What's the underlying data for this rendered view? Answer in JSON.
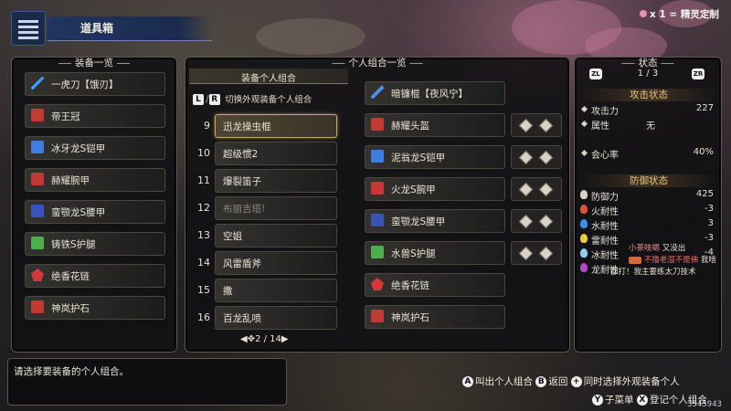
{
  "header": {
    "title": "道具箱"
  },
  "top_right": {
    "text": "x 1 = 精灵定制"
  },
  "equip_panel": {
    "title": "装备一览",
    "items": [
      {
        "label": "一虎刀【饿刃】",
        "icon": "long-sword-icon"
      },
      {
        "label": "帝王冠",
        "icon": "helm-icon"
      },
      {
        "label": "冰牙龙S铠甲",
        "icon": "chest-armor-icon"
      },
      {
        "label": "赫耀腕甲",
        "icon": "arm-armor-icon"
      },
      {
        "label": "蛮颚龙S腰甲",
        "icon": "waist-armor-icon"
      },
      {
        "label": "铸铁S护腿",
        "icon": "leg-armor-icon"
      },
      {
        "label": "绝香花链",
        "icon": "charm-icon"
      },
      {
        "label": "神岚护石",
        "icon": "talisman-icon"
      }
    ]
  },
  "loadout_panel": {
    "title": "个人组合一览",
    "subtitle": "装备个人组合",
    "switch_text": "切换外观装备个人组合",
    "switch_keys": [
      "L",
      "R"
    ],
    "slots": [
      {
        "num": "9",
        "label": "迅龙操虫棍",
        "selected": true
      },
      {
        "num": "10",
        "label": "超级惯2"
      },
      {
        "num": "11",
        "label": "爆裂笛子"
      },
      {
        "num": "12",
        "label": "布丽吉塔!",
        "dim": true
      },
      {
        "num": "13",
        "label": "空姐"
      },
      {
        "num": "14",
        "label": "风雷盾斧"
      },
      {
        "num": "15",
        "label": "撒"
      },
      {
        "num": "16",
        "label": "百龙乱喷"
      }
    ],
    "page": "2 / 14",
    "preview": [
      {
        "label": "暗镰棍【夜风宁】",
        "icon": "insect-glaive-icon"
      },
      {
        "label": "赫耀头盔",
        "icon": "helm-icon"
      },
      {
        "label": "泥翁龙S铠甲",
        "icon": "chest-armor-icon"
      },
      {
        "label": "火龙S腕甲",
        "icon": "arm-armor-icon"
      },
      {
        "label": "蛮颚龙S腰甲",
        "icon": "waist-armor-icon"
      },
      {
        "label": "水兽S护腿",
        "icon": "leg-armor-icon"
      },
      {
        "label": "绝香花链",
        "icon": "charm-icon"
      },
      {
        "label": "神岚护石",
        "icon": "talisman-icon"
      }
    ]
  },
  "status_panel": {
    "title": "状态",
    "page": "1 / 3",
    "attack_header": "攻击状态",
    "attack": [
      {
        "k": "攻击力",
        "v": "227"
      },
      {
        "k": "属性",
        "v": "无"
      },
      {
        "k": "会心率",
        "v": "40%"
      }
    ],
    "defense_header": "防御状态",
    "defense": [
      {
        "k": "防御力",
        "v": "425",
        "color": "#d8d3c4"
      },
      {
        "k": "火耐性",
        "v": "-3",
        "color": "#e0503a"
      },
      {
        "k": "水耐性",
        "v": "3",
        "color": "#3b8fe8"
      },
      {
        "k": "雷耐性",
        "v": "-3",
        "color": "#e8cf3a"
      },
      {
        "k": "冰耐性",
        "v": "-4",
        "color": "#8fd0f0"
      },
      {
        "k": "龙耐性",
        "v": "",
        "color": "#b04ac8"
      }
    ]
  },
  "chat": {
    "line1_name": "小茶吱嗯",
    "line1_text": "又没出",
    "line2_text": "不撸老湿不是佛",
    "line2_tail": "我啥",
    "line3_text": "都打！我主要练太刀技术"
  },
  "message": "请选择要装备的个人组合。",
  "hints": {
    "a": "叫出个人组合",
    "b": "返回",
    "plus": "同时选择外观装备个人",
    "y": "子菜单",
    "x": "登记个人组合"
  },
  "watermark": {
    "line1": "3545943"
  }
}
